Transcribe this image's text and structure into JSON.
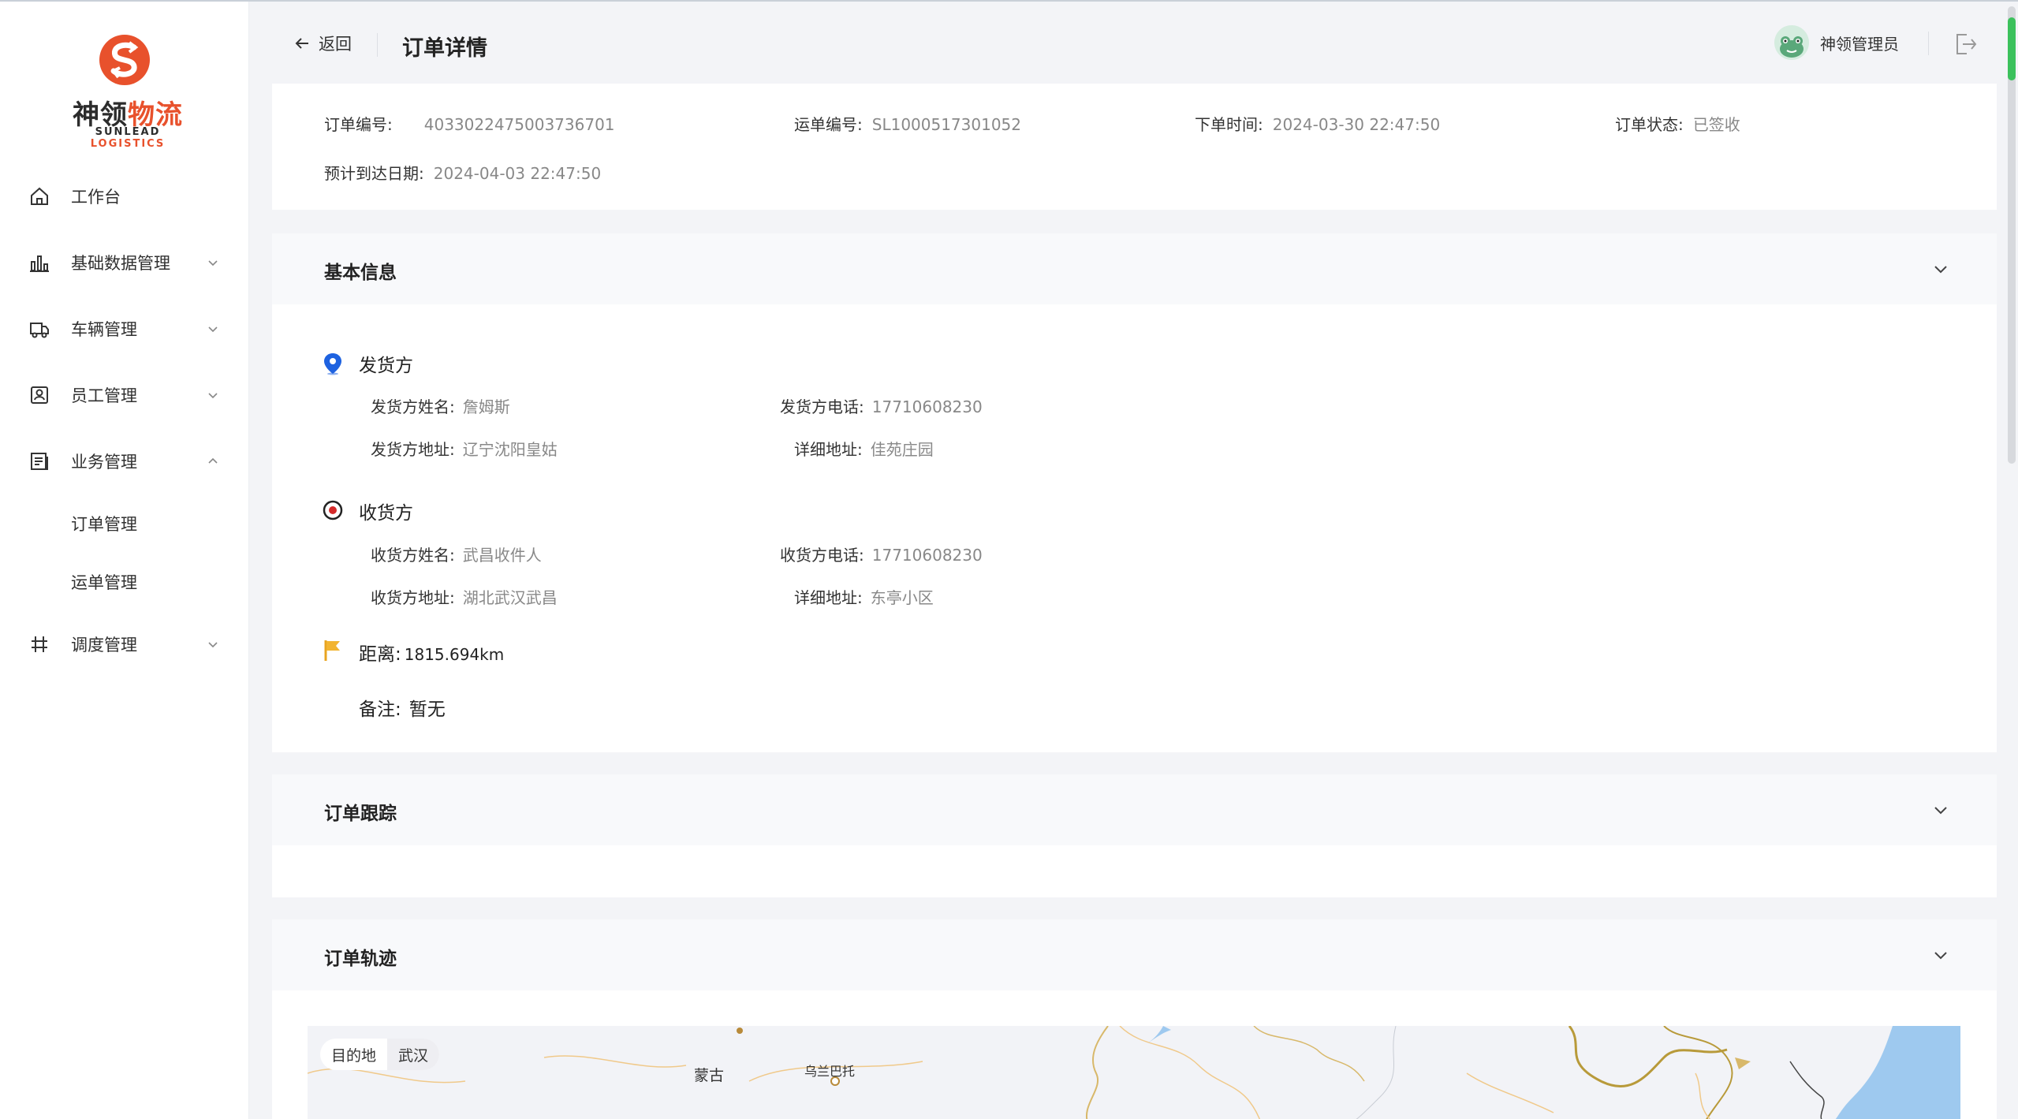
{
  "app": {
    "logo_cn_a": "神领",
    "logo_cn_b": "物流",
    "logo_en_a": "SUNLEAD",
    "logo_en_b": "LOGISTICS",
    "brand_color": "#e8512c"
  },
  "sidebar": {
    "items": [
      {
        "label": "工作台",
        "icon": "home-icon"
      },
      {
        "label": "基础数据管理",
        "icon": "chart-icon"
      },
      {
        "label": "车辆管理",
        "icon": "truck-icon"
      },
      {
        "label": "员工管理",
        "icon": "badge-icon"
      },
      {
        "label": "业务管理",
        "icon": "document-icon"
      },
      {
        "label": "调度管理",
        "icon": "dispatch-icon"
      }
    ],
    "sub_items": [
      {
        "label": "订单管理"
      },
      {
        "label": "运单管理"
      }
    ]
  },
  "header": {
    "back_label": "返回",
    "title": "订单详情",
    "username": "神领管理员"
  },
  "summary": {
    "order_no_label": "订单编号:",
    "order_no": "4033022475003736701",
    "waybill_no_label": "运单编号:",
    "waybill_no": "SL1000517301052",
    "order_time_label": "下单时间:",
    "order_time": "2024-03-30 22:47:50",
    "status_label": "订单状态:",
    "status": "已签收",
    "eta_label": "预计到达日期:",
    "eta": "2024-04-03 22:47:50"
  },
  "basic": {
    "title": "基本信息",
    "sender": {
      "title": "发货方",
      "name_label": "发货方姓名:",
      "name": "詹姆斯",
      "phone_label": "发货方电话:",
      "phone": "17710608230",
      "address_label": "发货方地址:",
      "address": "辽宁沈阳皇姑",
      "detail_label": "详细地址:",
      "detail": "佳苑庄园"
    },
    "receiver": {
      "title": "收货方",
      "name_label": "收货方姓名:",
      "name": "武昌收件人",
      "phone_label": "收货方电话:",
      "phone": "17710608230",
      "address_label": "收货方地址:",
      "address": "湖北武汉武昌",
      "detail_label": "详细地址:",
      "detail": "东亭小区"
    },
    "distance_label": "距离:",
    "distance": "1815.694km",
    "remark_label": "备注:",
    "remark": "暂无"
  },
  "tracking": {
    "title": "订单跟踪"
  },
  "trajectory": {
    "title": "订单轨迹",
    "map_tag_label": "目的地",
    "map_tag_value": "武汉",
    "map_places": [
      "蒙古",
      "乌兰巴托"
    ]
  }
}
